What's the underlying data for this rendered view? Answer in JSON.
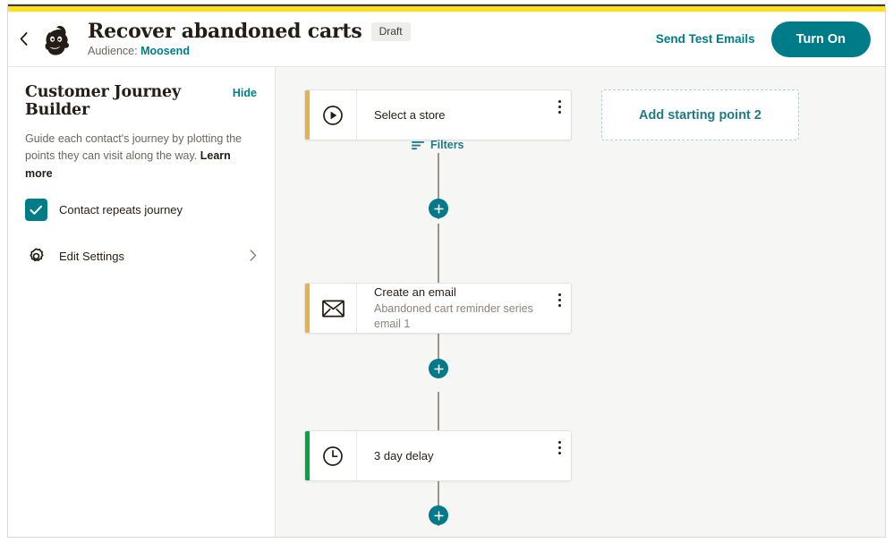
{
  "header": {
    "back_icon": "chevron-left-icon",
    "logo": "mailchimp-freddie-logo",
    "title": "Recover abandoned carts",
    "status_badge": "Draft",
    "audience_label": "Audience:",
    "audience_name": "Moosend",
    "send_test_label": "Send Test Emails",
    "turn_on_label": "Turn On"
  },
  "sidebar": {
    "title": "Customer Journey Builder",
    "hide_label": "Hide",
    "description": "Guide each contact's journey by plotting the points they can visit along the way.",
    "learn_more_label": "Learn more",
    "checkbox": {
      "label": "Contact repeats journey",
      "checked": true
    },
    "settings": {
      "icon": "gear-icon",
      "label": "Edit Settings",
      "chevron": "chevron-right-icon"
    }
  },
  "canvas": {
    "filters_label": "Filters",
    "add_starting_point_label": "Add starting point 2",
    "nodes": [
      {
        "icon": "play-circle-icon",
        "title": "Select a store",
        "subtitle": "",
        "accent": "amber",
        "menu_icon": "kebab-menu-icon"
      },
      {
        "icon": "envelope-icon",
        "title": "Create an email",
        "subtitle": "Abandoned cart reminder series email 1",
        "accent": "amber",
        "menu_icon": "kebab-menu-icon"
      },
      {
        "icon": "clock-icon",
        "title": "3 day delay",
        "subtitle": "",
        "accent": "green",
        "menu_icon": "kebab-menu-icon"
      }
    ],
    "add_step_label": "+"
  },
  "colors": {
    "brand_yellow": "#ffe01b",
    "teal": "#007c89",
    "amber_accent": "#e8b14b",
    "green_accent": "#00a63f",
    "canvas_bg": "#f6f6f4"
  }
}
